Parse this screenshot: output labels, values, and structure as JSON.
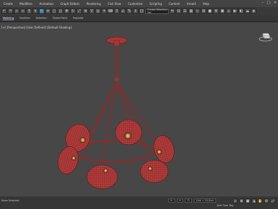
{
  "menu": {
    "items": [
      "Create",
      "Modifiers",
      "Animation",
      "Graph Editors",
      "Rendering",
      "Civil View",
      "Customize",
      "Scripting",
      "Content",
      "Arnold",
      "Help"
    ],
    "window_controls": [
      "minimize-icon",
      "maximize-icon",
      "close-icon"
    ]
  },
  "toolbar": {
    "selection_set_placeholder": "Create Selection Set"
  },
  "ribbon": {
    "tabs": [
      "Modeling",
      "Freeform",
      "Selection",
      "Object Paint",
      "Populate"
    ]
  },
  "viewport": {
    "label": "[+] [Perspective] [User Defined] [Default Shading]",
    "background_color": "#474747",
    "model_color": "#a33838"
  },
  "status": {
    "left_text": "None Selected",
    "x_label": "X:",
    "y_label": "Y:",
    "z_label": "Z:",
    "grid_text": "Grid = 10,0cm",
    "add_time_tag": "Add Time Tag"
  }
}
